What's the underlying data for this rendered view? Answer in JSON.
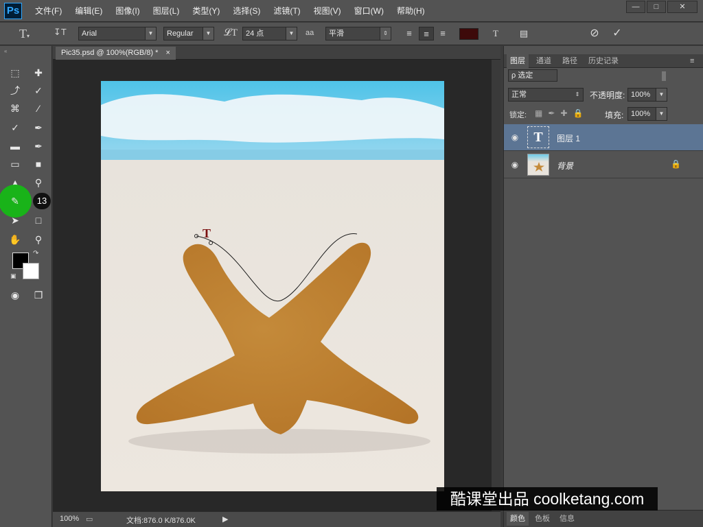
{
  "app": {
    "logo": "Ps"
  },
  "menu": [
    "文件(F)",
    "编辑(E)",
    "图像(I)",
    "图层(L)",
    "类型(Y)",
    "选择(S)",
    "滤镜(T)",
    "视图(V)",
    "窗口(W)",
    "帮助(H)"
  ],
  "options": {
    "font_family": "Arial",
    "font_style": "Regular",
    "font_size": "24 点",
    "antialias_icon": "aa",
    "antialias": "平滑",
    "text_color": "#3d0a0a"
  },
  "toolbox": {
    "badge": "13",
    "foreground_color": "#000000",
    "background_color": "#ffffff"
  },
  "document": {
    "tab_title": "Pic35.psd @ 100%(RGB/8) *",
    "tab_close": "×"
  },
  "status": {
    "zoom": "100%",
    "doc_info": "文档:876.0 K/876.0K"
  },
  "layers_panel": {
    "tabs": [
      "图层",
      "通道",
      "路径",
      "历史记录"
    ],
    "filter_label": "ρ 选定",
    "blend_mode": "正常",
    "opacity_label": "不透明度:",
    "opacity_value": "100%",
    "lock_label": "锁定:",
    "fill_label": "填充:",
    "fill_value": "100%",
    "layers": [
      {
        "name": "图层 1",
        "type": "text",
        "selected": true
      },
      {
        "name": "背景",
        "type": "image",
        "locked": true
      }
    ]
  },
  "bottom_tabs": [
    "颜色",
    "色板",
    "信息"
  ],
  "watermark": "酷课堂出品 coolketang.com"
}
